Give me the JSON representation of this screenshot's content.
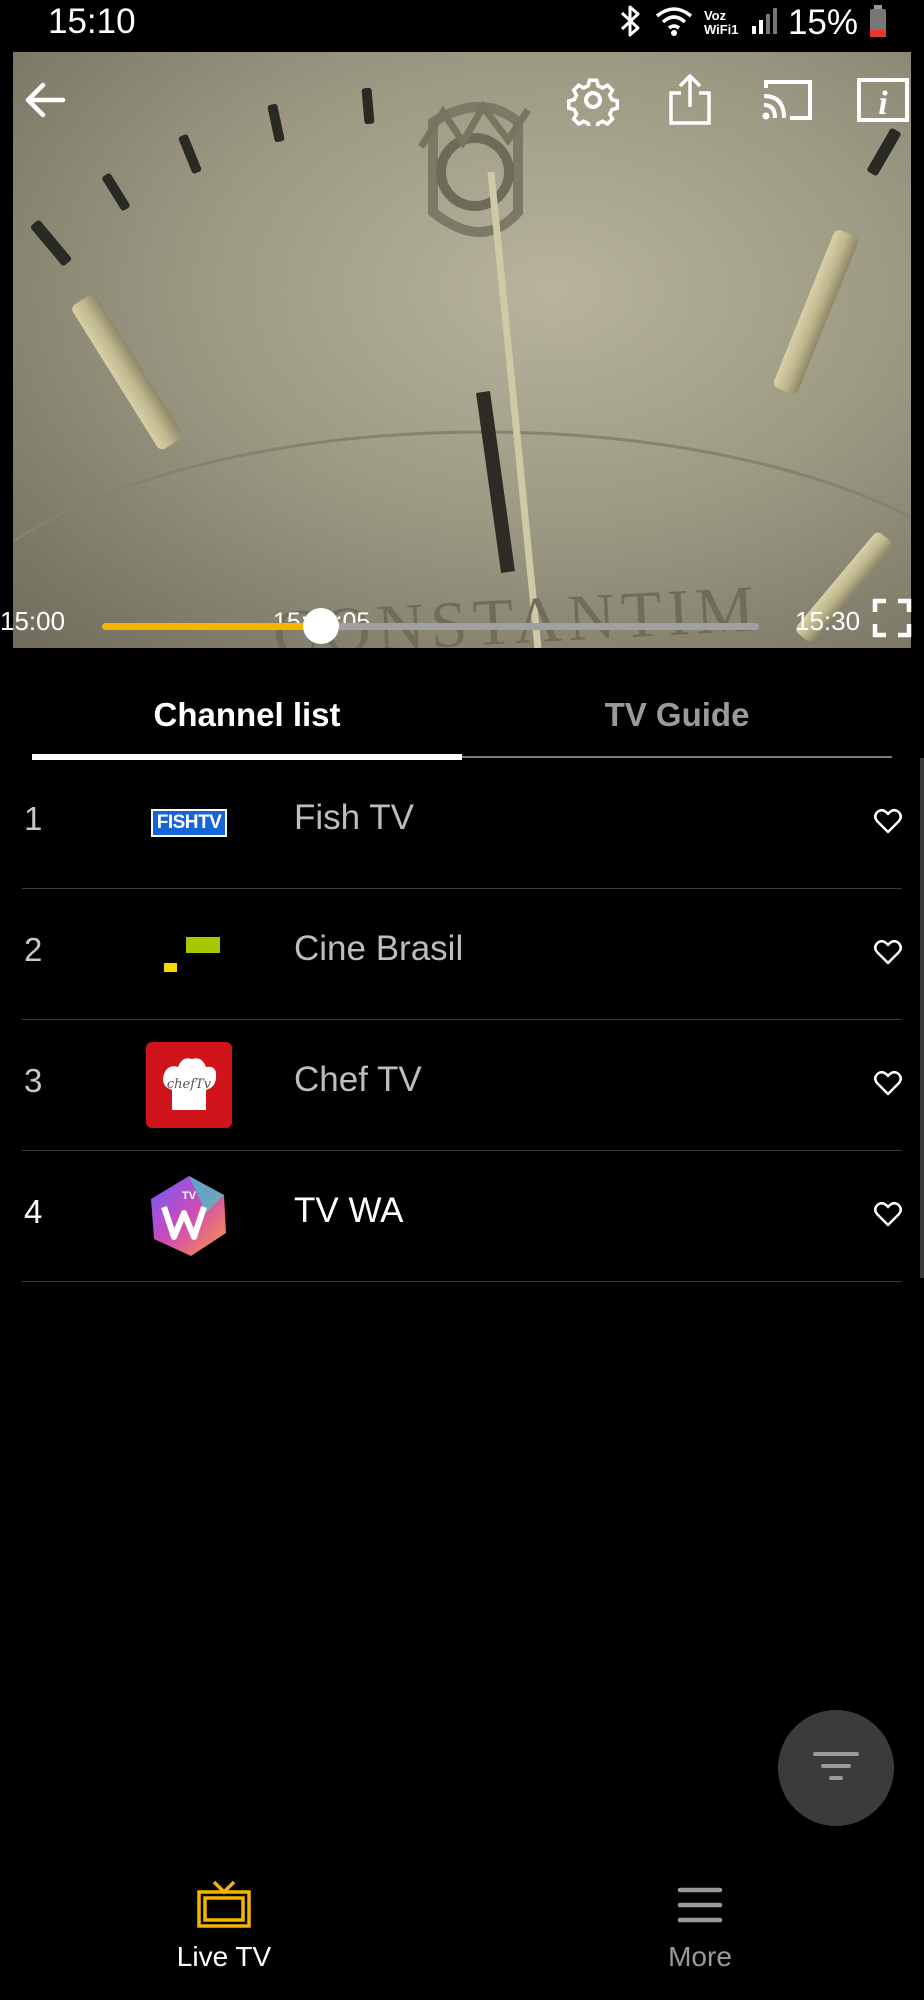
{
  "status_bar": {
    "time": "15:10",
    "carrier_text": "Voz WiFi1",
    "battery": "15%",
    "icons": [
      "bluetooth-icon",
      "wifi-icon",
      "signal-icon",
      "battery-icon"
    ]
  },
  "player": {
    "icons": [
      "back-icon",
      "settings-icon",
      "share-icon",
      "cast-icon",
      "info-icon",
      "fullscreen-icon"
    ],
    "current_time": "15:10:05",
    "start_time": "15:00",
    "end_time": "15:30",
    "progress_fraction": 0.333,
    "watermark_text": "CONSTANTIM"
  },
  "tabs": [
    {
      "label": "Channel list",
      "active": true
    },
    {
      "label": "TV Guide",
      "active": false
    }
  ],
  "channels": [
    {
      "number": "1",
      "name": "Fish TV",
      "logo": "fish-tv-logo",
      "logo_text": "FISHTV",
      "active": false
    },
    {
      "number": "2",
      "name": "Cine Brasil",
      "logo": "cine-brasil-logo",
      "active": false
    },
    {
      "number": "3",
      "name": "Chef TV",
      "logo": "chef-tv-logo",
      "logo_text": "chefTv",
      "active": false
    },
    {
      "number": "4",
      "name": "TV WA",
      "logo": "tv-wa-logo",
      "logo_text": "TV",
      "active": true
    }
  ],
  "fab": {
    "icon": "filter-icon"
  },
  "bottom_nav": [
    {
      "label": "Live TV",
      "icon": "tv-icon",
      "active": true
    },
    {
      "label": "More",
      "icon": "menu-icon",
      "active": false
    }
  ],
  "colors": {
    "accent": "#f4b500",
    "background": "#000000",
    "inactive_text": "#9a9a9a"
  }
}
